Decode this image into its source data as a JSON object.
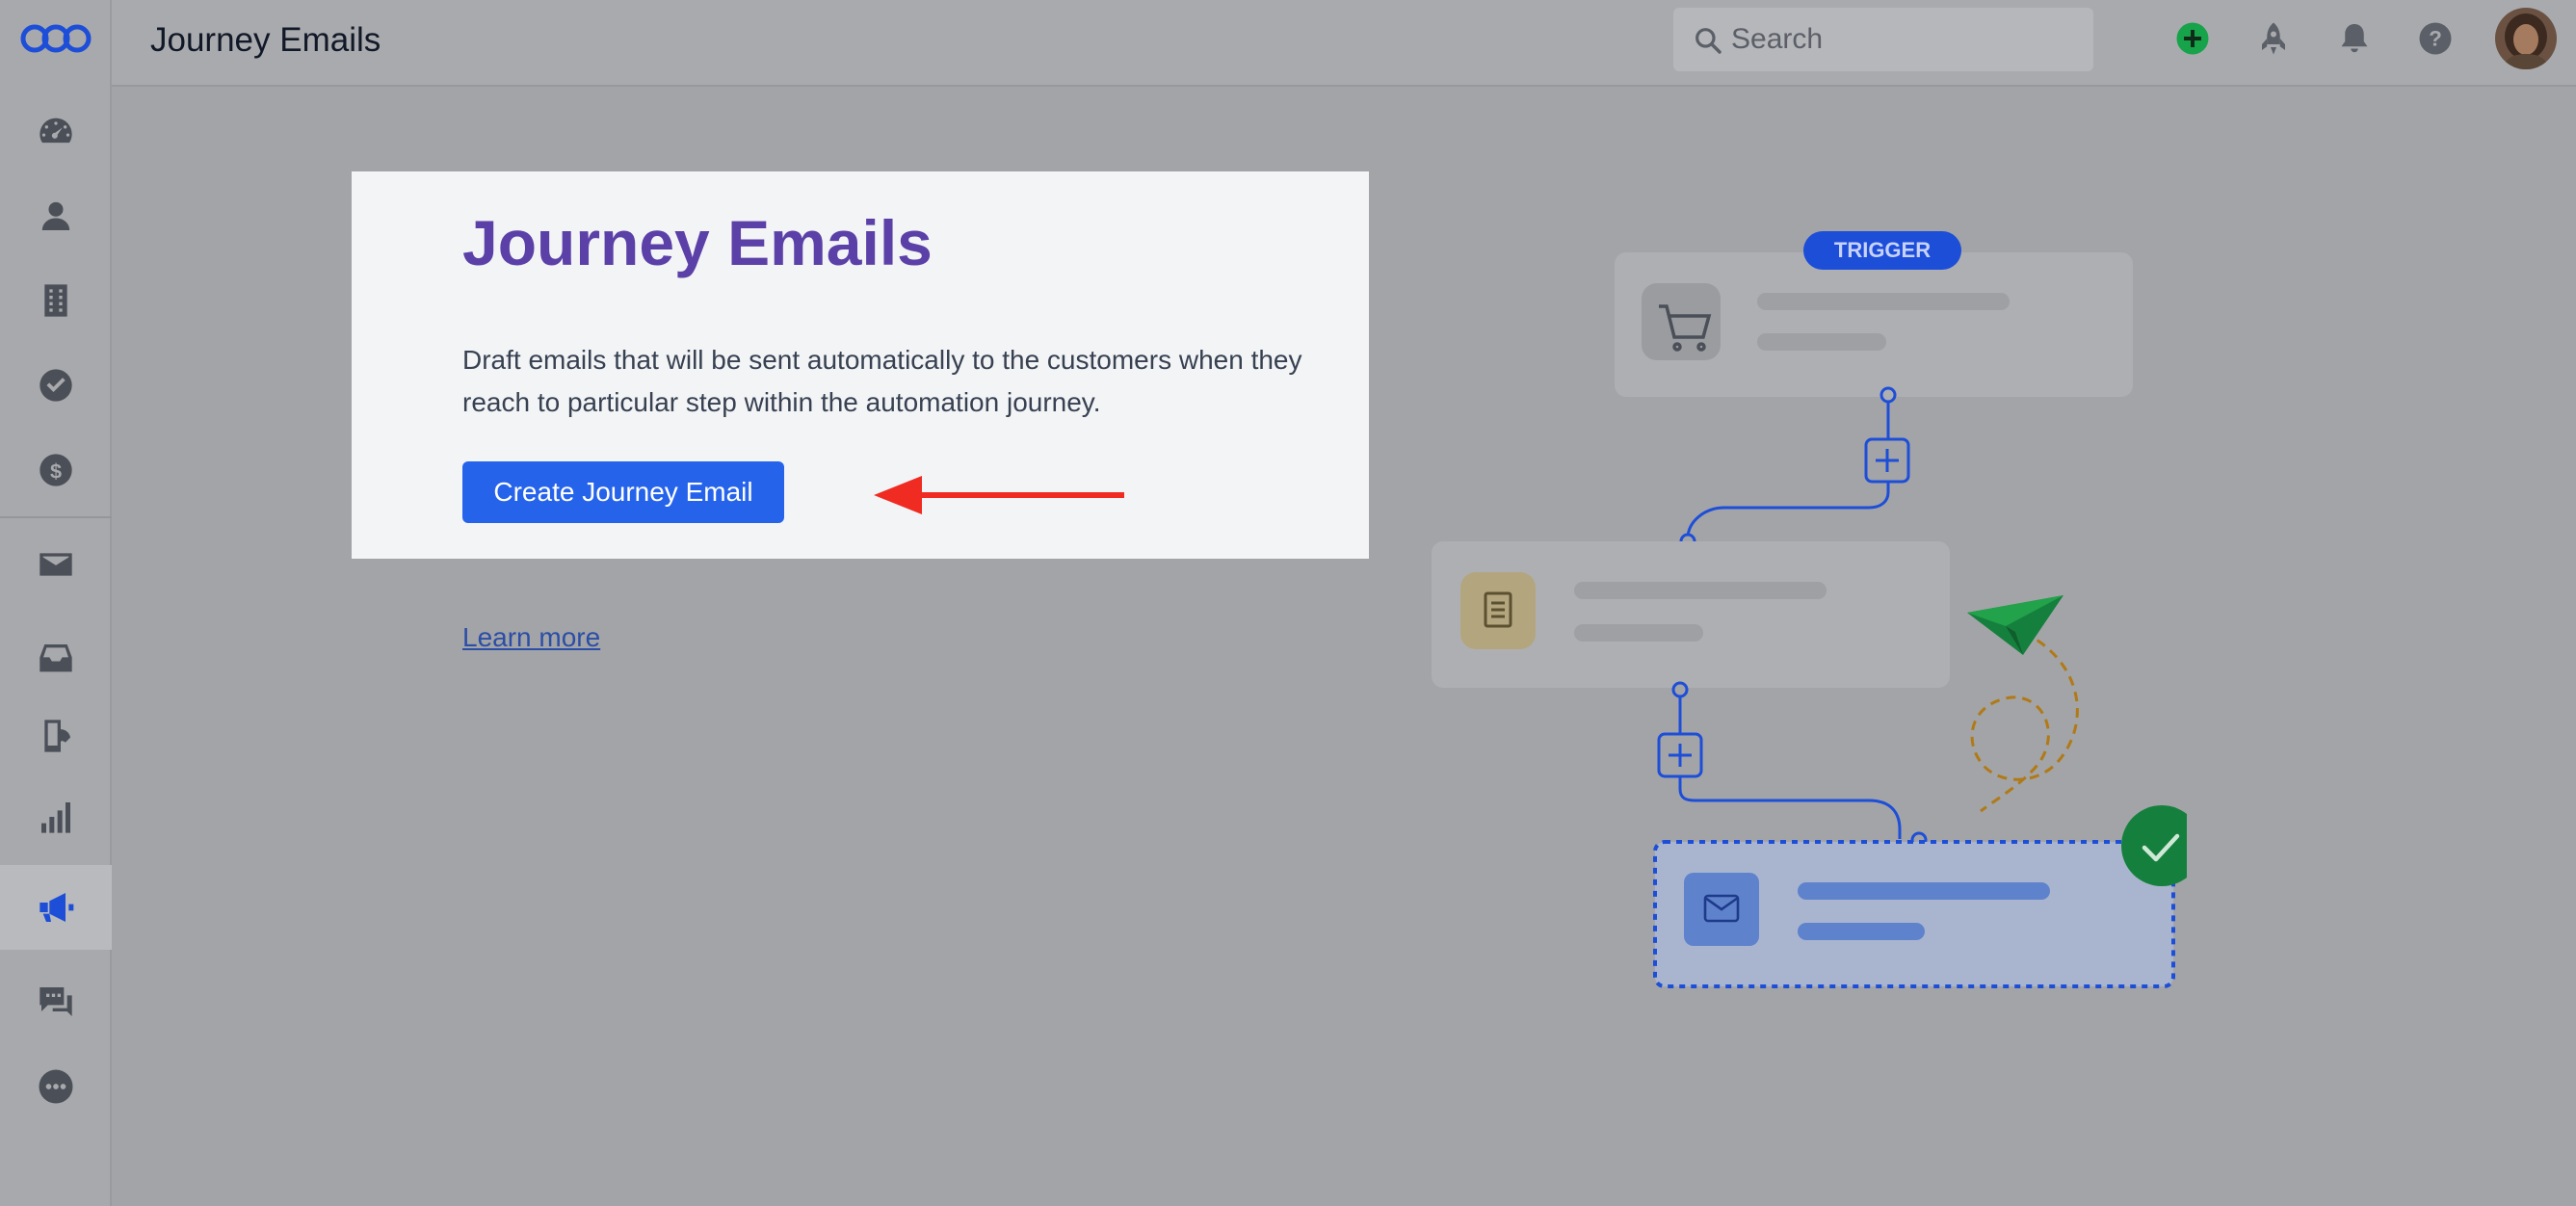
{
  "header": {
    "title": "Journey Emails",
    "search_placeholder": "Search"
  },
  "sidebar": {
    "items": [
      {
        "icon": "dashboard-icon"
      },
      {
        "icon": "contacts-icon"
      },
      {
        "icon": "companies-icon"
      },
      {
        "icon": "tasks-icon"
      },
      {
        "icon": "deals-icon"
      },
      {
        "icon": "email-icon"
      },
      {
        "icon": "inbox-icon"
      },
      {
        "icon": "phone-icon"
      },
      {
        "icon": "reports-icon"
      },
      {
        "icon": "campaigns-icon",
        "active": true
      },
      {
        "icon": "chat-icon"
      },
      {
        "icon": "more-icon"
      }
    ]
  },
  "main": {
    "heading": "Journey Emails",
    "description": "Draft emails that will be sent automatically to the customers when they reach to particular step within the automation journey.",
    "cta_label": "Create Journey Email",
    "learn_more": "Learn more"
  },
  "illustration": {
    "trigger_label": "TRIGGER"
  },
  "colors": {
    "brand": "#1d4ed8",
    "heading": "#5b40a8",
    "button": "#2563eb",
    "annotation_arrow": "#ef2b22",
    "success": "#15803d"
  }
}
